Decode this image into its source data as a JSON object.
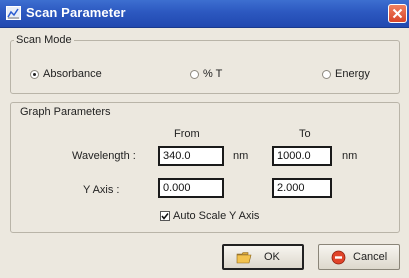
{
  "window": {
    "title": "Scan Parameter",
    "app_icon": "chart-icon",
    "close_icon": "close-icon"
  },
  "scan_mode": {
    "label": "Scan Mode",
    "options": [
      {
        "label": "Absorbance",
        "selected": true
      },
      {
        "label": "% T",
        "selected": false
      },
      {
        "label": "Energy",
        "selected": false
      }
    ]
  },
  "graph": {
    "label": "Graph Parameters",
    "from_header": "From",
    "to_header": "To",
    "wavelength_label": "Wavelength :",
    "wavelength_from": "340.0",
    "wavelength_to": "1000.0",
    "unit": "nm",
    "yaxis_label": "Y Axis :",
    "yaxis_from": "0.000",
    "yaxis_to": "2.000",
    "auto_scale_label": "Auto Scale Y Axis",
    "auto_scale_checked": true
  },
  "buttons": {
    "ok_label": "OK",
    "ok_icon": "folder-icon",
    "cancel_label": "Cancel",
    "cancel_icon": "stop-icon"
  }
}
